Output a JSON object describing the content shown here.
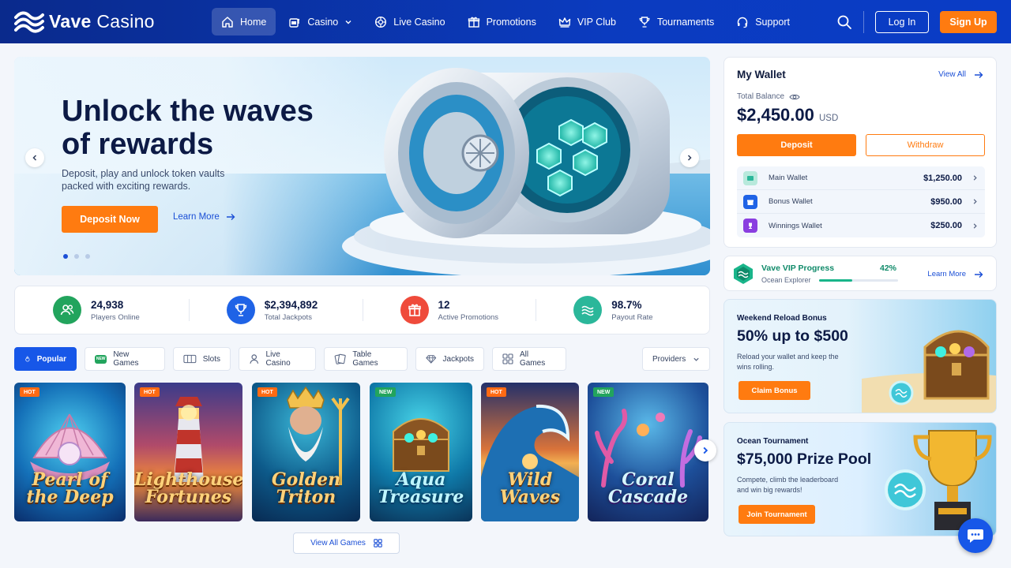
{
  "brand": {
    "name_bold": "Vave",
    "name_light": "Casino"
  },
  "nav": {
    "items": [
      {
        "label": "Home",
        "icon": "home-icon",
        "active": true
      },
      {
        "label": "Casino",
        "icon": "slot-icon",
        "has_dropdown": true
      },
      {
        "label": "Live Casino",
        "icon": "chip-icon"
      },
      {
        "label": "Promotions",
        "icon": "gift-icon"
      },
      {
        "label": "VIP Club",
        "icon": "crown-icon"
      },
      {
        "label": "Tournaments",
        "icon": "trophy-icon"
      },
      {
        "label": "Support",
        "icon": "headset-icon"
      }
    ],
    "login_label": "Log In",
    "signup_label": "Sign Up"
  },
  "hero": {
    "title_line1": "Unlock the waves",
    "title_line2": "of rewards",
    "description": "Deposit, play and unlock token vaults packed with exciting rewards.",
    "cta_label": "Deposit Now",
    "learn_label": "Learn More",
    "slides": 3,
    "active_slide": 1
  },
  "stats": [
    {
      "value": "24,938",
      "label": "Players Online",
      "icon": "users-icon",
      "color": "#22a45d"
    },
    {
      "value": "$2,394,892",
      "label": "Total Jackpots",
      "icon": "trophy-icon",
      "color": "#1f63e6"
    },
    {
      "value": "12",
      "label": "Active Promotions",
      "icon": "gift-icon",
      "color": "#ef4b3b"
    },
    {
      "value": "98.7%",
      "label": "Payout Rate",
      "icon": "waves-icon",
      "color": "#2bb79a"
    }
  ],
  "tabs": [
    {
      "label": "Popular",
      "icon": "flame-icon",
      "active": true
    },
    {
      "label": "New Games",
      "icon": "new-badge-icon"
    },
    {
      "label": "Slots",
      "icon": "slot-icon"
    },
    {
      "label": "Live Casino",
      "icon": "person-icon"
    },
    {
      "label": "Table Games",
      "icon": "cards-icon"
    },
    {
      "label": "Jackpots",
      "icon": "diamond-icon"
    },
    {
      "label": "All Games",
      "icon": "grid-icon"
    }
  ],
  "providers_label": "Providers",
  "games": [
    {
      "title": "Pearl of the Deep",
      "badge": "HOT"
    },
    {
      "title": "Lighthouse Fortunes",
      "badge": "HOT"
    },
    {
      "title": "Golden Triton",
      "badge": "HOT"
    },
    {
      "title": "Aqua Treasure",
      "badge": "NEW"
    },
    {
      "title": "Wild Waves",
      "badge": "HOT"
    },
    {
      "title": "Coral Cascade",
      "badge": "NEW"
    }
  ],
  "view_all_label": "View All Games",
  "wallet": {
    "title": "My Wallet",
    "view_all": "View All",
    "total_label": "Total Balance",
    "balance": "$2,450.00",
    "currency": "USD",
    "deposit_label": "Deposit",
    "withdraw_label": "Withdraw",
    "rows": [
      {
        "name": "Main Wallet",
        "amount": "$1,250.00",
        "color": "#2bb79a"
      },
      {
        "name": "Bonus Wallet",
        "amount": "$950.00",
        "color": "#1f63e6"
      },
      {
        "name": "Winnings Wallet",
        "amount": "$250.00",
        "color": "#8a3ee0"
      }
    ]
  },
  "vip": {
    "title": "Vave VIP Progress",
    "level": "Ocean Explorer",
    "percent_label": "42%",
    "progress": 0.42,
    "learn_label": "Learn More"
  },
  "promo1": {
    "kicker": "Weekend Reload Bonus",
    "headline": "50% up to $500",
    "description": "Reload your wallet and keep the wins rolling.",
    "button": "Claim Bonus"
  },
  "promo2": {
    "kicker": "Ocean Tournament",
    "headline": "$75,000 Prize Pool",
    "description": "Compete, climb the leaderboard and win big rewards!",
    "button": "Join Tournament"
  },
  "colors": {
    "primary": "#1757e8",
    "accent": "#ff7b10",
    "nav_bg": "#0b3bbf"
  }
}
